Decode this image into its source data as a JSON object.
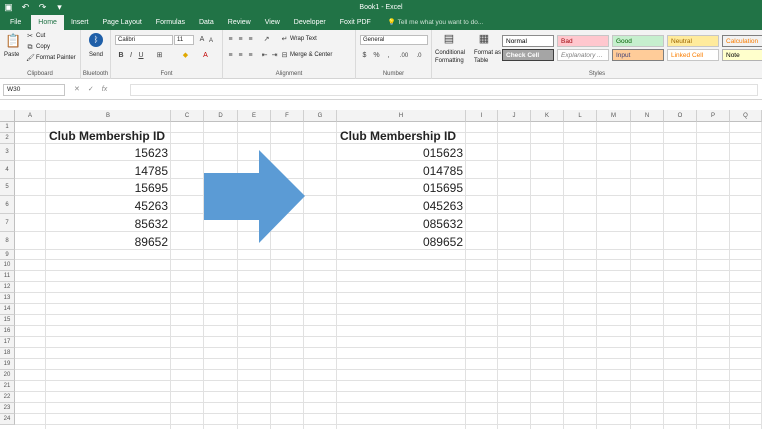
{
  "title_bar": {
    "document_title": "Book1 - Excel",
    "qat_icons": [
      "save-icon",
      "undo-icon",
      "redo-icon",
      "customize-qat-icon"
    ]
  },
  "tabs": [
    "File",
    "Home",
    "Insert",
    "Page Layout",
    "Formulas",
    "Data",
    "Review",
    "View",
    "Developer",
    "Foxit PDF"
  ],
  "active_tab": "Home",
  "tell_me": "Tell me what you want to do...",
  "ribbon": {
    "clipboard": {
      "label": "Clipboard",
      "paste": "Paste",
      "cut": "Cut",
      "copy": "Copy",
      "format_painter": "Format Painter"
    },
    "bluetooth": {
      "label": "Bluetooth",
      "send": "Send"
    },
    "font": {
      "label": "Font",
      "name": "Calibri",
      "size": "11",
      "bold": "B",
      "italic": "I",
      "underline": "U"
    },
    "alignment": {
      "label": "Alignment",
      "wrap_text": "Wrap Text",
      "merge_center": "Merge & Center"
    },
    "number": {
      "label": "Number",
      "format": "General",
      "currency": "$",
      "percent": "%",
      "comma": ",",
      "inc_decimal": ".00",
      "dec_decimal": ".0"
    },
    "styles": {
      "label": "Styles",
      "conditional_formatting": [
        "Conditional",
        "Formatting"
      ],
      "format_as_table": [
        "Format as",
        "Table"
      ],
      "cells": [
        {
          "name": "Normal",
          "bg": "#ffffff",
          "fg": "#000000",
          "border": "#8c8c8c"
        },
        {
          "name": "Bad",
          "bg": "#ffc7ce",
          "fg": "#9c0006"
        },
        {
          "name": "Good",
          "bg": "#c6efce",
          "fg": "#006100"
        },
        {
          "name": "Neutral",
          "bg": "#ffeb9c",
          "fg": "#9c6500"
        },
        {
          "name": "Calculation",
          "bg": "#f2f2f2",
          "fg": "#fa7d00",
          "border": "#7f7f7f"
        },
        {
          "name": "Check Cell",
          "bg": "#a5a5a5",
          "fg": "#ffffff",
          "border": "#3f3f3f"
        },
        {
          "name": "Explanatory ...",
          "bg": "#ffffff",
          "fg": "#7f7f7f"
        },
        {
          "name": "Input",
          "bg": "#ffcc99",
          "fg": "#3f3f76",
          "border": "#7f7f7f"
        },
        {
          "name": "Linked Cell",
          "bg": "#ffffff",
          "fg": "#fa7d00"
        },
        {
          "name": "Note",
          "bg": "#ffffcc",
          "fg": "#000000",
          "border": "#b2b2b2"
        }
      ]
    }
  },
  "formula_bar": {
    "name_box": "W30",
    "fx": "fx",
    "cancel": "✕",
    "enter": "✓",
    "value": ""
  },
  "columns": [
    "A",
    "B",
    "C",
    "D",
    "E",
    "F",
    "G",
    "H",
    "I",
    "J",
    "K",
    "L",
    "M",
    "N",
    "O",
    "P",
    "Q"
  ],
  "rows": [
    "1",
    "2",
    "3",
    "4",
    "5",
    "6",
    "7",
    "8",
    "9",
    "10",
    "11",
    "12",
    "13",
    "14",
    "15",
    "16",
    "17",
    "18",
    "19",
    "20",
    "21",
    "22",
    "23",
    "24"
  ],
  "sheet": {
    "left_header": "Club Membership ID",
    "left_values": [
      "15623",
      "14785",
      "15695",
      "45263",
      "85632",
      "89652"
    ],
    "right_header": "Club Membership ID",
    "right_values": [
      "015623",
      "014785",
      "015695",
      "045263",
      "085632",
      "089652"
    ]
  },
  "arrow": {
    "shape": "right-arrow",
    "color": "#5b9bd5"
  },
  "colors": {
    "excel_green": "#217346",
    "ribbon_bg": "#f3f3f3",
    "gridline": "#e1e1e1"
  }
}
